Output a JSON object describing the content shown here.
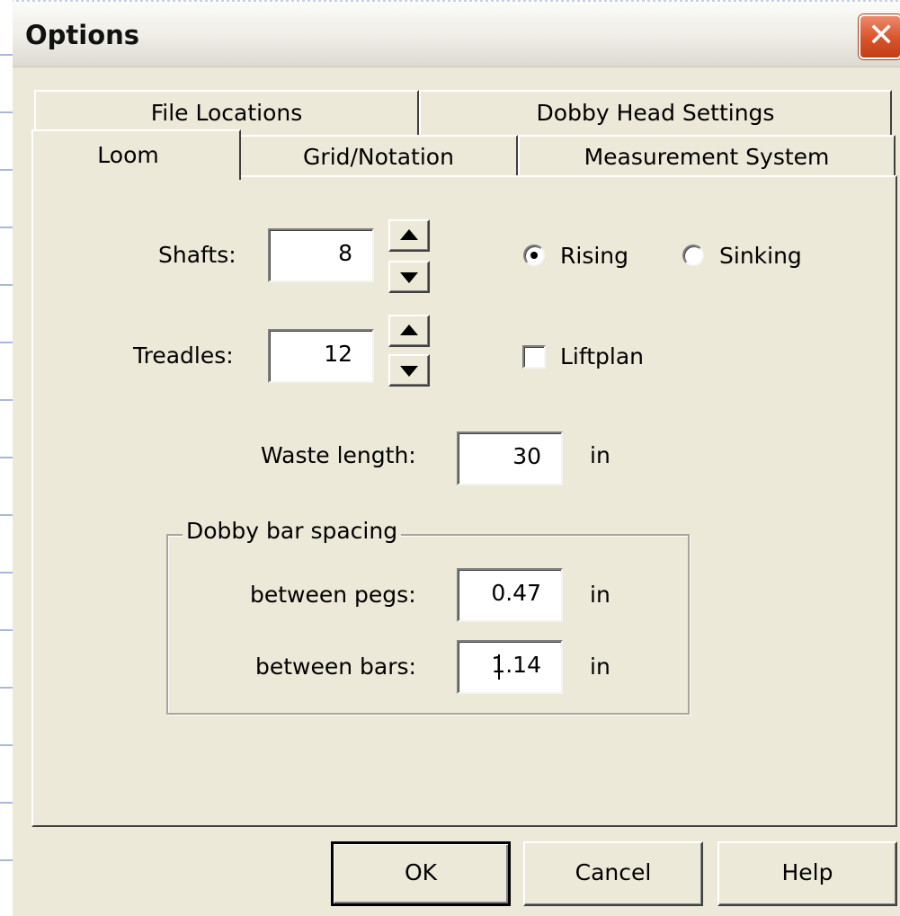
{
  "window": {
    "title": "Options",
    "close_symbol": "✕"
  },
  "tabs": {
    "row_back": [
      "File Locations",
      "Dobby Head Settings"
    ],
    "row_front": [
      "Loom",
      "Grid/Notation",
      "Measurement System"
    ],
    "active": "Loom"
  },
  "loom": {
    "shafts": {
      "label": "Shafts:",
      "value": "8"
    },
    "treadles": {
      "label": "Treadles:",
      "value": "12"
    },
    "shed_mode": {
      "options": [
        "Rising",
        "Sinking"
      ],
      "selected": "Rising"
    },
    "liftplan": {
      "label": "Liftplan",
      "checked": false
    },
    "waste_length": {
      "label": "Waste length:",
      "value": "30",
      "unit": "in"
    },
    "dobby_bar_spacing": {
      "legend": "Dobby bar spacing",
      "between_pegs": {
        "label": "between pegs:",
        "value": "0.47",
        "unit": "in"
      },
      "between_bars": {
        "label": "between bars:",
        "value": "1.14",
        "unit": "in"
      }
    }
  },
  "buttons": {
    "ok": "OK",
    "cancel": "Cancel",
    "help": "Help"
  },
  "colors": {
    "dialog_bg": "#ece9d8",
    "close_button": "#d8532a",
    "field_bg": "#ffffff"
  }
}
